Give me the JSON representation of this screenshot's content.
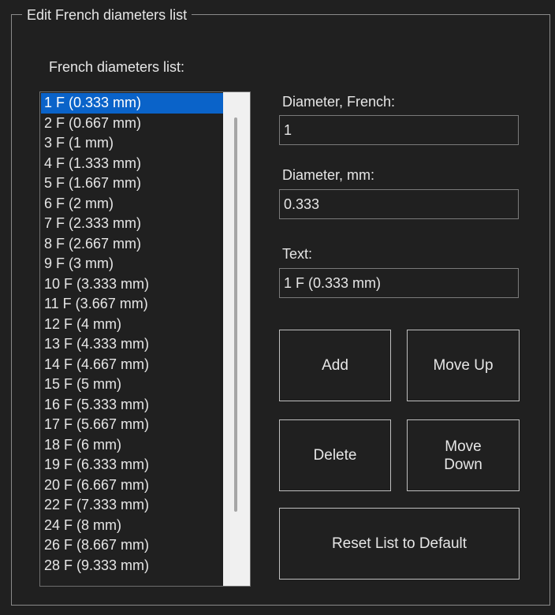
{
  "group_title": "Edit French diameters list",
  "list_label": "French diameters list:",
  "list_items": [
    "1 F (0.333 mm)",
    "2 F (0.667 mm)",
    "3 F (1 mm)",
    "4 F (1.333 mm)",
    "5 F (1.667 mm)",
    "6 F (2 mm)",
    "7 F (2.333 mm)",
    "8 F (2.667 mm)",
    "9 F (3 mm)",
    "10 F (3.333 mm)",
    "11 F (3.667 mm)",
    "12 F (4 mm)",
    "13 F (4.333 mm)",
    "14 F (4.667 mm)",
    "15 F (5 mm)",
    "16 F (5.333 mm)",
    "17 F (5.667 mm)",
    "18 F (6 mm)",
    "19 F (6.333 mm)",
    "20 F (6.667 mm)",
    "22 F (7.333 mm)",
    "24 F (8 mm)",
    "26 F (8.667 mm)",
    "28 F (9.333 mm)"
  ],
  "selected_index": 0,
  "fields": {
    "french_label": "Diameter, French:",
    "french_value": "1",
    "mm_label": "Diameter, mm:",
    "mm_value": "0.333",
    "text_label": "Text:",
    "text_value": "1 F (0.333 mm)"
  },
  "buttons": {
    "add": "Add",
    "move_up": "Move Up",
    "delete": "Delete",
    "move_down": "Move\nDown",
    "reset": "Reset List to Default"
  },
  "colors": {
    "background": "#202020",
    "selection": "#0a63c9",
    "text": "#e6e6e6"
  }
}
